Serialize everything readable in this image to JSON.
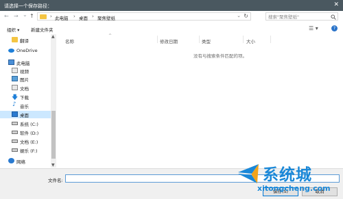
{
  "window": {
    "title": "请选择一个保存路径：",
    "close_glyph": "✕"
  },
  "nav": {
    "back": "←",
    "forward": "→",
    "recent": "⌄",
    "up": "↑"
  },
  "address": {
    "crumbs": [
      "此电脑",
      "桌面",
      "聚焦壁纸"
    ],
    "separator": "›",
    "dropdown": "⌄",
    "refresh": "↻"
  },
  "search": {
    "placeholder": "搜索\"聚焦壁纸\"",
    "icon": "search-icon"
  },
  "toolbar": {
    "organize": "组织 ▾",
    "new_folder": "新建文件夹",
    "view_glyph": "☰ ▾",
    "help_glyph": "?"
  },
  "sidebar": {
    "items": [
      {
        "label": "翻译",
        "icon": "folder-icon"
      },
      {
        "label": "OneDrive",
        "icon": "cloud-icon"
      },
      {
        "label": "此电脑",
        "icon": "computer-icon"
      },
      {
        "label": "视频",
        "icon": "video-icon"
      },
      {
        "label": "图片",
        "icon": "picture-icon"
      },
      {
        "label": "文档",
        "icon": "document-icon"
      },
      {
        "label": "下载",
        "icon": "download-icon"
      },
      {
        "label": "音乐",
        "icon": "music-icon"
      },
      {
        "label": "桌面",
        "icon": "desktop-icon",
        "selected": true
      },
      {
        "label": "系统 (C:)",
        "icon": "drive-icon"
      },
      {
        "label": "软件 (D:)",
        "icon": "drive-icon"
      },
      {
        "label": "文档 (E:)",
        "icon": "drive-icon"
      },
      {
        "label": "娱乐 (F:)",
        "icon": "drive-icon"
      },
      {
        "label": "网络",
        "icon": "network-icon"
      }
    ]
  },
  "columns": [
    "名称",
    "修改日期",
    "类型",
    "大小"
  ],
  "empty_message": "没有与搜索条件匹配的项。",
  "filename": {
    "label": "文件名:",
    "value": ""
  },
  "buttons": {
    "save": "保存(S)",
    "cancel": "取消"
  },
  "watermark": {
    "text": "系统城",
    "url": "xitongcheng.com"
  },
  "colors": {
    "titlebar": "#4a5860",
    "selection": "#cce8ff",
    "accent": "#0078d7",
    "watermark": "#1a88d8"
  }
}
